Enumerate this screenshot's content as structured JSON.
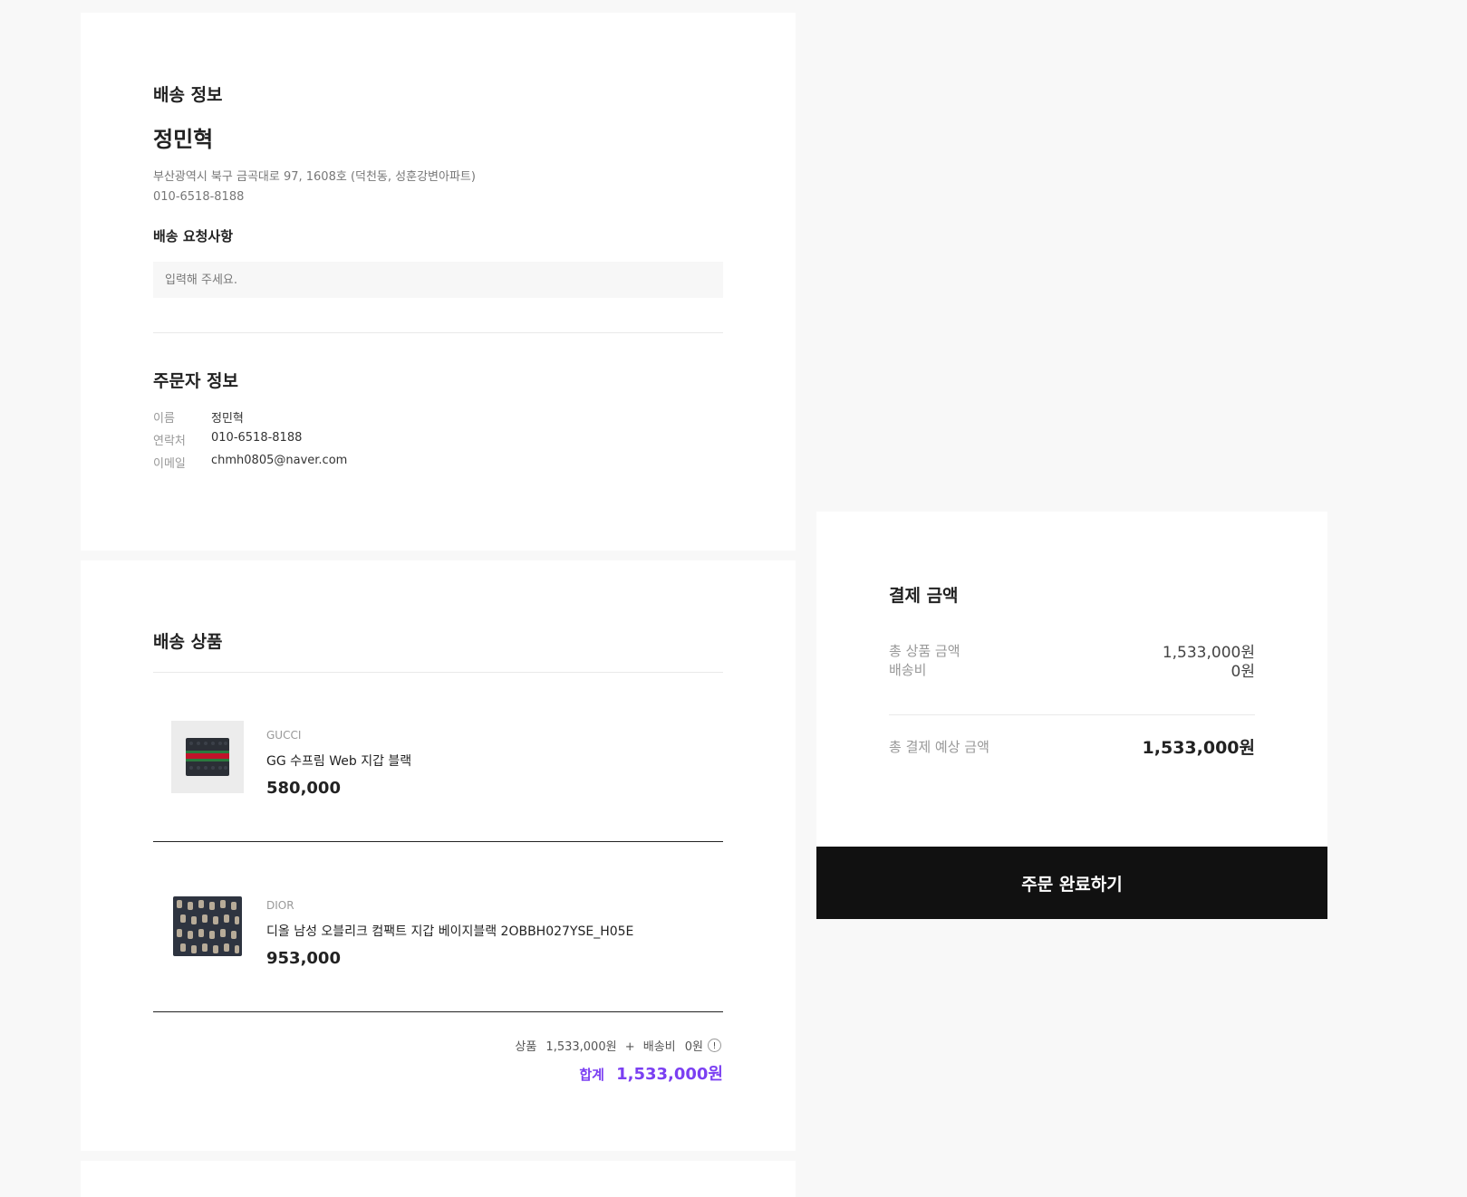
{
  "delivery": {
    "title": "배송 정보",
    "recipient_name": "정민혁",
    "address": "부산광역시 북구 금곡대로 97, 1608호 (덕천동, 성훈강변아파트)",
    "phone": "010-6518-8188",
    "request_title": "배송 요청사항",
    "request_placeholder": "입력해 주세요.",
    "request_value": ""
  },
  "orderer": {
    "title": "주문자 정보",
    "rows": [
      {
        "label": "이름",
        "value": "정민혁"
      },
      {
        "label": "연락처",
        "value": "010-6518-8188"
      },
      {
        "label": "이메일",
        "value": "chmh0805@naver.com"
      }
    ]
  },
  "products": {
    "title": "배송 상품",
    "items": [
      {
        "brand": "GUCCI",
        "name": "GG 수프림 Web 지갑 블랙",
        "price": "580,000"
      },
      {
        "brand": "DIOR",
        "name": "디올 남성 오블리크 컴팩트 지갑 베이지블랙 2OBBH027YSE_H05E",
        "price": "953,000"
      }
    ],
    "summary_product_label": "상품",
    "summary_product_value": "1,533,000원",
    "summary_plus": "+",
    "summary_shipping_label": "배송비",
    "summary_shipping_value": "0원",
    "info_icon_glyph": "!",
    "total_label": "합계",
    "total_value": "1,533,000원",
    "accent_color": "#7b3ff2"
  },
  "payment": {
    "title": "결제 금액",
    "product_total_label": "총 상품 금액",
    "product_total_value": "1,533,000원",
    "shipping_label": "배송비",
    "shipping_value": "0원",
    "expected_total_label": "총 결제 예상 금액",
    "expected_total_value": "1,533,000원",
    "complete_button_label": "주문 완료하기"
  }
}
